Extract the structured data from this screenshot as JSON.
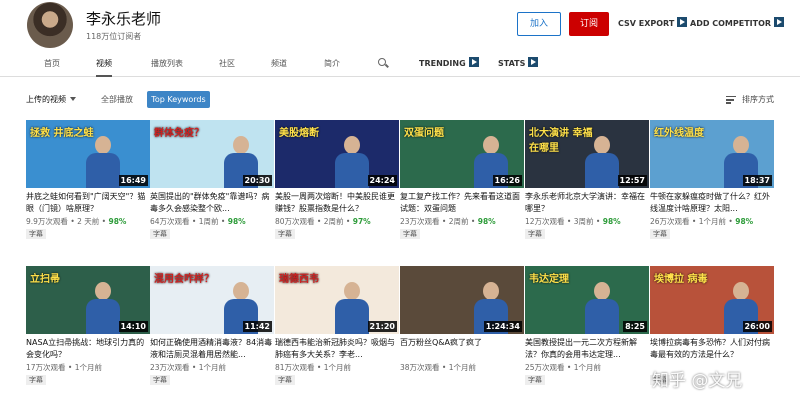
{
  "channel": {
    "name": "李永乐老师",
    "subscribers": "118万位订阅者",
    "join_label": "加入",
    "subscribe_label": "订阅"
  },
  "toolbar": {
    "csv_export": "CSV EXPORT",
    "add_competitor": "ADD COMPETITOR"
  },
  "tabs": [
    "首页",
    "视频",
    "播放列表",
    "社区",
    "频道",
    "简介"
  ],
  "ext_tabs": {
    "trending": "TRENDING",
    "stats": "STATS"
  },
  "filter": {
    "uploaded": "上传的视频",
    "all_play": "全部播放",
    "top_keywords": "Top Keywords",
    "sort": "排序方式"
  },
  "videos": [
    {
      "duration": "16:49",
      "title": "井底之蛙如何看到\"广阔天空\"？猫眼（门镜）啥原理？",
      "views": "9.9万次观看",
      "age": "2 天前",
      "pct": "98%",
      "tag": "字幕",
      "caption": "拯救 井底之蛙",
      "bg": "#3a8fd0"
    },
    {
      "duration": "20:30",
      "title": "英国提出的\"群体免疫\"靠谱吗？病毒多久会感染整个欧...",
      "views": "64万次观看",
      "age": "1周前",
      "pct": "98%",
      "tag": "字幕",
      "caption": "群体免疫？",
      "bg": "#bfe3f0"
    },
    {
      "duration": "24:24",
      "title": "美股一周两次熔断！中美股民谁更赚钱？股票指数是什么？",
      "views": "80万次观看",
      "age": "2周前",
      "pct": "97%",
      "tag": "字幕",
      "caption": "美股熔断",
      "bg": "#1c2a6a"
    },
    {
      "duration": "16:26",
      "title": "复工复产找工作？先来看看这道面试题：双蛋问题",
      "views": "23万次观看",
      "age": "2周前",
      "pct": "98%",
      "tag": "字幕",
      "caption": "双蛋问题",
      "bg": "#2c6a4c"
    },
    {
      "duration": "12:57",
      "title": "李永乐老师北京大学演讲：幸福在哪里？",
      "views": "12万次观看",
      "age": "3周前",
      "pct": "98%",
      "tag": "字幕",
      "caption": "北大演讲 幸福在哪里",
      "bg": "#2a3340"
    },
    {
      "duration": "18:37",
      "title": "牛顿在家躲瘟疫时做了什么？红外线温度计啥原理？太阳...",
      "views": "26万次观看",
      "age": "1个月前",
      "pct": "98%",
      "tag": "字幕",
      "caption": "红外线温度",
      "bg": "#5ca0d0"
    },
    {
      "duration": "14:10",
      "title": "NASA立扫帚挑战：地球引力真的会变化吗？",
      "views": "17万次观看",
      "age": "1个月前",
      "pct": "",
      "tag": "字幕",
      "caption": "立扫帚",
      "bg": "#2d5f4a"
    },
    {
      "duration": "11:42",
      "title": "如何正确使用酒精消毒液？84消毒液和洁厕灵混着用居然能...",
      "views": "23万次观看",
      "age": "1个月前",
      "pct": "",
      "tag": "字幕",
      "caption": "混用会咋样？",
      "bg": "#e7eef3"
    },
    {
      "duration": "21:20",
      "title": "瑞德西韦能治新冠肺炎吗？吸烟与肺癌有多大关系？李老...",
      "views": "81万次观看",
      "age": "1个月前",
      "pct": "",
      "tag": "字幕",
      "caption": "瑞德西韦",
      "bg": "#f3e9dc"
    },
    {
      "duration": "1:24:34",
      "title": "百万粉丝Q&A疯了疯了",
      "views": "38万次观看",
      "age": "1个月前",
      "pct": "",
      "tag": "",
      "caption": "",
      "bg": "#5a4a3a"
    },
    {
      "duration": "8:25",
      "title": "美国教授提出一元二次方程新解法？你真的会用韦达定理...",
      "views": "25万次观看",
      "age": "1个月前",
      "pct": "",
      "tag": "字幕",
      "caption": "韦达定理",
      "bg": "#2c6a4c"
    },
    {
      "duration": "26:00",
      "title": "埃博拉病毒有多恐怖？人们对付病毒最有效的方法是什么？",
      "views": "",
      "age": "",
      "pct": "",
      "tag": "字幕",
      "caption": "埃博拉 病毒",
      "bg": "#b8523a"
    }
  ],
  "watermark": "知乎 @文兄",
  "colors": {
    "accent": "#3d85c6",
    "subscribe": "#cc0000",
    "pct_green": "#2e9c3a"
  }
}
